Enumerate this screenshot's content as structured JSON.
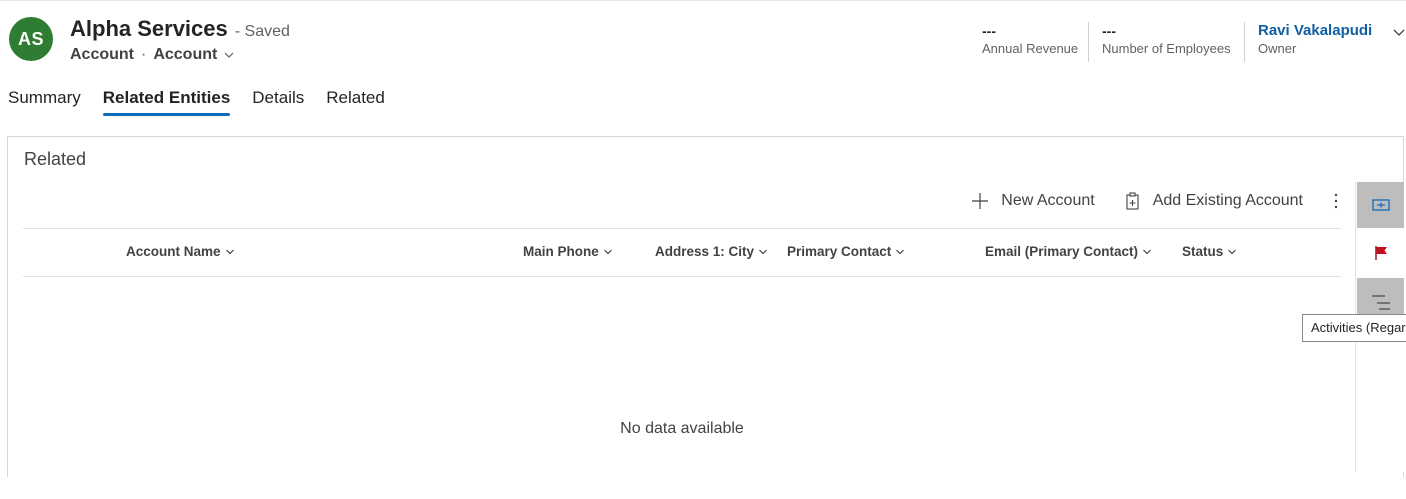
{
  "header": {
    "avatar_initials": "AS",
    "avatar_color": "#2e7d32",
    "title": "Alpha Services",
    "saved_status": "- Saved",
    "entity_type": "Account",
    "form_name": "Account",
    "kpis": [
      {
        "value": "---",
        "label": "Annual Revenue"
      },
      {
        "value": "---",
        "label": "Number of Employees"
      },
      {
        "value": "Ravi Vakalapudi",
        "label": "Owner"
      }
    ]
  },
  "tabs": [
    {
      "label": "Summary",
      "active": false
    },
    {
      "label": "Related Entities",
      "active": true
    },
    {
      "label": "Details",
      "active": false
    },
    {
      "label": "Related",
      "active": false
    }
  ],
  "section": {
    "title": "Related",
    "commands": {
      "new": "New Account",
      "add_existing": "Add Existing Account"
    },
    "columns": [
      "Account Name",
      "Main Phone",
      "Address 1: City",
      "Primary Contact",
      "Email (Primary Contact)",
      "Status"
    ],
    "empty_message": "No data available"
  },
  "rail": {
    "tooltip": "Activities (Regarding)",
    "icons": [
      "form-relationship-icon",
      "flag-icon",
      "activities-icon"
    ]
  },
  "colors": {
    "accent": "#0f6cbd",
    "link": "#115ea3",
    "flag": "#c50f1f"
  }
}
